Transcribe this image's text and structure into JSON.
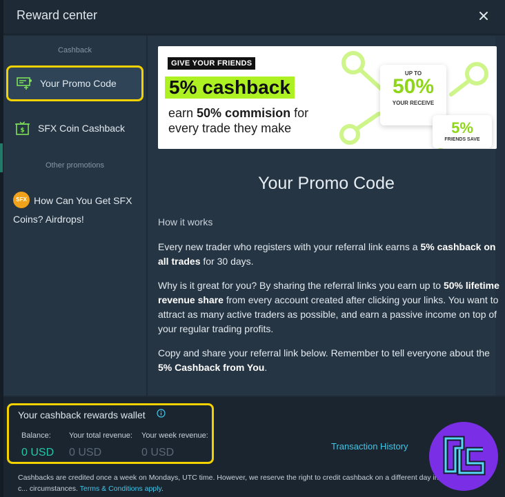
{
  "header": {
    "title": "Reward center"
  },
  "sidebar": {
    "section_cashback": "Cashback",
    "section_other": "Other promotions",
    "items": [
      {
        "label": "Your Promo Code",
        "icon": "promo-code-icon",
        "active": true
      },
      {
        "label": "SFX Coin Cashback",
        "icon": "sfx-cashback-icon",
        "active": false
      }
    ],
    "airdrop": {
      "badge": "SFX",
      "label": "How Can You Get SFX Coins? Airdrops!"
    }
  },
  "banner": {
    "tag": "GIVE YOUR FRIENDS",
    "headline": "5% cashback",
    "sub_prefix": "earn ",
    "sub_bold": "50% commision",
    "sub_suffix": " for every trade they make",
    "card1_top": "UP TO",
    "card1_value": "50%",
    "card1_bottom": "YOUR RECEIVE",
    "card2_value": "5%",
    "card2_bottom": "FRIENDS SAVE"
  },
  "main": {
    "title": "Your Promo Code",
    "how_it_works": "How it works",
    "p1_a": "Every new trader who registers with your referral link earns a ",
    "p1_b": "5% cashback on all trades",
    "p1_c": " for 30 days.",
    "p2_a": "Why is it great for you? By sharing the referral links you earn up to ",
    "p2_b": "50% lifetime revenue share",
    "p2_c": " from every account created after clicking your links. You want to attract as many active traders as possible, and earn a passive income on top of your regular trading profits.",
    "p3_a": "Copy and share your referral link below. Remember to tell everyone about the ",
    "p3_b": "5% Cashback from You",
    "p3_c": "."
  },
  "wallet": {
    "title": "Your cashback rewards wallet",
    "balance_label": "Balance:",
    "balance_value": "0 USD",
    "total_label": "Your total revenue:",
    "total_value": "0 USD",
    "week_label": "Your week revenue:",
    "week_value": "0 USD",
    "transaction_history": "Transaction History",
    "footnote_text": "Cashbacks are credited once a week on Mondays, UTC time. However, we reserve the right to credit cashback on a different day in c... circumstances. ",
    "footnote_link": "Terms & Conditions apply",
    "footnote_end": "."
  },
  "colors": {
    "accent_yellow": "#f3d200",
    "link": "#43c7e8",
    "balance_green": "#26c6a8",
    "banner_green": "#aef123",
    "logo_purple": "#7a2fe6"
  }
}
